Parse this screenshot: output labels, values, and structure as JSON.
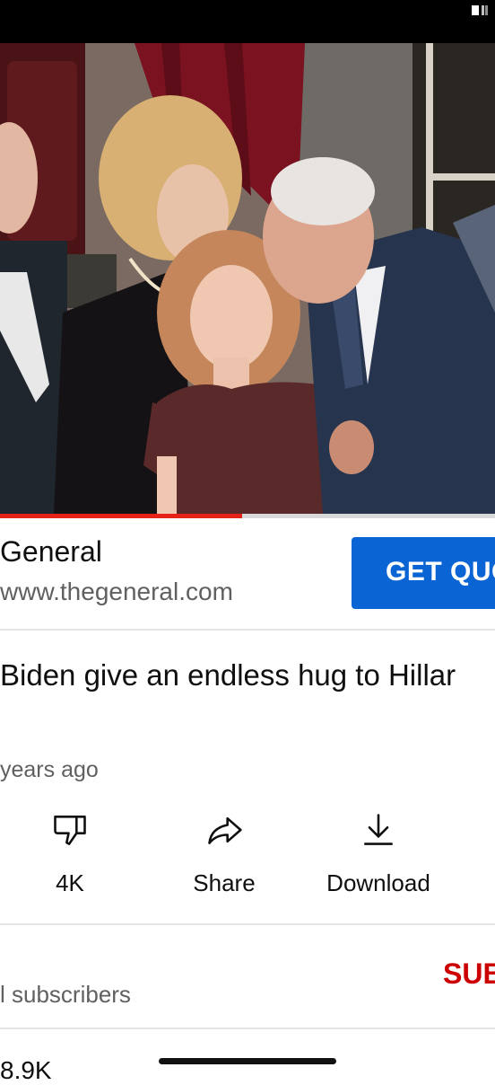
{
  "video": {
    "thumbnail": "video-frame-image",
    "progress_fraction": 0.49
  },
  "ad": {
    "advertiser": "General",
    "url": "www.thegeneral.com",
    "cta_label": "GET QUO"
  },
  "video_title": "Biden give an endless hug to Hillar",
  "meta_text": "years ago",
  "actions": {
    "dislike_label": "4K",
    "share_label": "Share",
    "download_label": "Download"
  },
  "channel": {
    "subscribers_text": "l subscribers",
    "subscribe_label": "SUB"
  },
  "comments_count": "8.9K",
  "colors": {
    "progress": "#e62117",
    "cta_bg": "#0b64d4",
    "subscribe": "#cc0000"
  }
}
